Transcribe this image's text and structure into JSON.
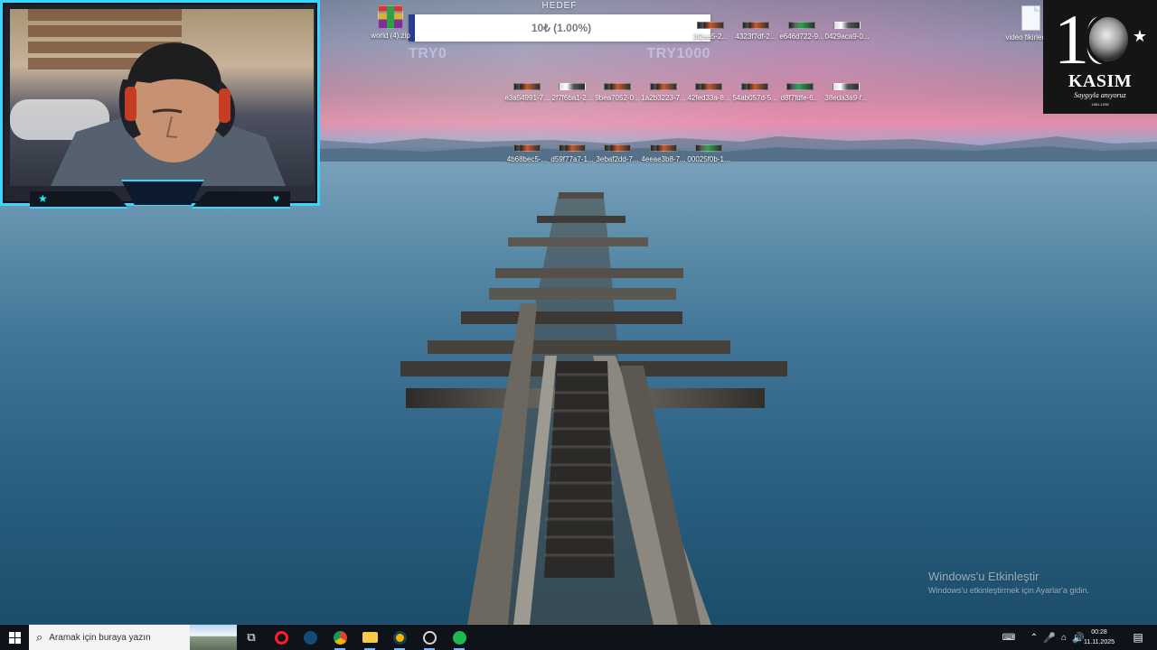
{
  "desktop": {
    "icons": [
      {
        "label": "world (4).zip",
        "type": "zip"
      },
      {
        "label": "3f2ea5-2...",
        "type": "image"
      },
      {
        "label": "4323f7df-2...",
        "type": "image"
      },
      {
        "label": "e646d722-9...",
        "type": "image"
      },
      {
        "label": "0429aca9-0...",
        "type": "image"
      },
      {
        "label": "video fikirleri.txt",
        "type": "text"
      },
      {
        "label": "e3a54991-7...",
        "type": "image"
      },
      {
        "label": "2f7f6ba1-2...",
        "type": "image"
      },
      {
        "label": "9bea7052-0...",
        "type": "image"
      },
      {
        "label": "1a2b3223-7...",
        "type": "image"
      },
      {
        "label": "42fed33a-8...",
        "type": "image"
      },
      {
        "label": "54ab057d-5...",
        "type": "image"
      },
      {
        "label": "d8f7fdfe-6...",
        "type": "image"
      },
      {
        "label": "38eda3a9-f...",
        "type": "image"
      },
      {
        "label": "4b68bec5-...",
        "type": "image"
      },
      {
        "label": "d59f77a7-1...",
        "type": "image"
      },
      {
        "label": "3ebaf2dd-7...",
        "type": "image"
      },
      {
        "label": "4eeae3b8-7...",
        "type": "image"
      },
      {
        "label": "00025f0b-1...",
        "type": "image"
      }
    ]
  },
  "goal": {
    "title": "HEDEF",
    "value": "10₺ (1.00%)",
    "min_label": "TRY0",
    "max_label": "TRY1000",
    "progress": 0.01
  },
  "overlay": {
    "number": "10",
    "title": "KASIM",
    "subtitle": "Saygıyla anıyoruz",
    "years": "1881-1938"
  },
  "activation": {
    "title": "Windows'u Etkinleştir",
    "message": "Windows'u etkinleştirmek için Ayarlar'a gidin."
  },
  "taskbar": {
    "search_placeholder": "Aramak için buraya yazın",
    "time": "00:28",
    "date": "11.11.2025"
  },
  "colors": {
    "webcam_accent": "#33d7ff",
    "goal_fill": "#24379c",
    "taskbar_bg": "#0e1117"
  },
  "icons": {
    "start": "windows-logo-icon",
    "search": "search-icon",
    "task_view": "task-view-icon",
    "opera": "opera-icon",
    "steam": "steam-icon",
    "chrome": "chrome-icon",
    "explorer": "file-explorer-icon",
    "spotify": "spotify-icon",
    "notifications": "notification-icon"
  }
}
